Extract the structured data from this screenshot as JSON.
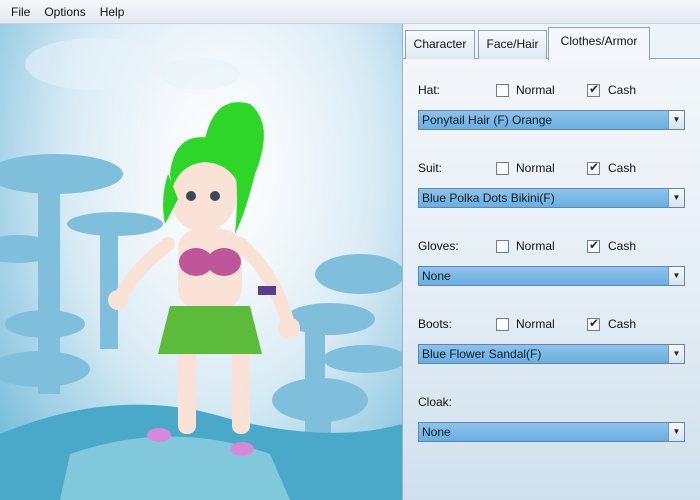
{
  "menu": {
    "items": [
      "File",
      "Options",
      "Help"
    ]
  },
  "tabs": [
    {
      "label": "Character",
      "active": false
    },
    {
      "label": "Face/Hair",
      "active": false
    },
    {
      "label": "Clothes/Armor",
      "active": true
    }
  ],
  "slots": [
    {
      "label": "Hat:",
      "normal_label": "Normal",
      "normal_checked": false,
      "cash_label": "Cash",
      "cash_checked": true,
      "selected": "Ponytail Hair (F) Orange"
    },
    {
      "label": "Suit:",
      "normal_label": "Normal",
      "normal_checked": false,
      "cash_label": "Cash",
      "cash_checked": true,
      "selected": "Blue Polka Dots Bikini(F)"
    },
    {
      "label": "Gloves:",
      "normal_label": "Normal",
      "normal_checked": false,
      "cash_label": "Cash",
      "cash_checked": true,
      "selected": "None"
    },
    {
      "label": "Boots:",
      "normal_label": "Normal",
      "normal_checked": false,
      "cash_label": "Cash",
      "cash_checked": true,
      "selected": "Blue Flower Sandal(F)"
    },
    {
      "label": "Cloak:",
      "selected": "None"
    }
  ],
  "colors": {
    "hair": "#2fd62a",
    "bikini_top": "#c0569a",
    "skirt": "#5cbb3a",
    "skin": "#fbe2d6",
    "dropdown": "#79b8e6"
  }
}
